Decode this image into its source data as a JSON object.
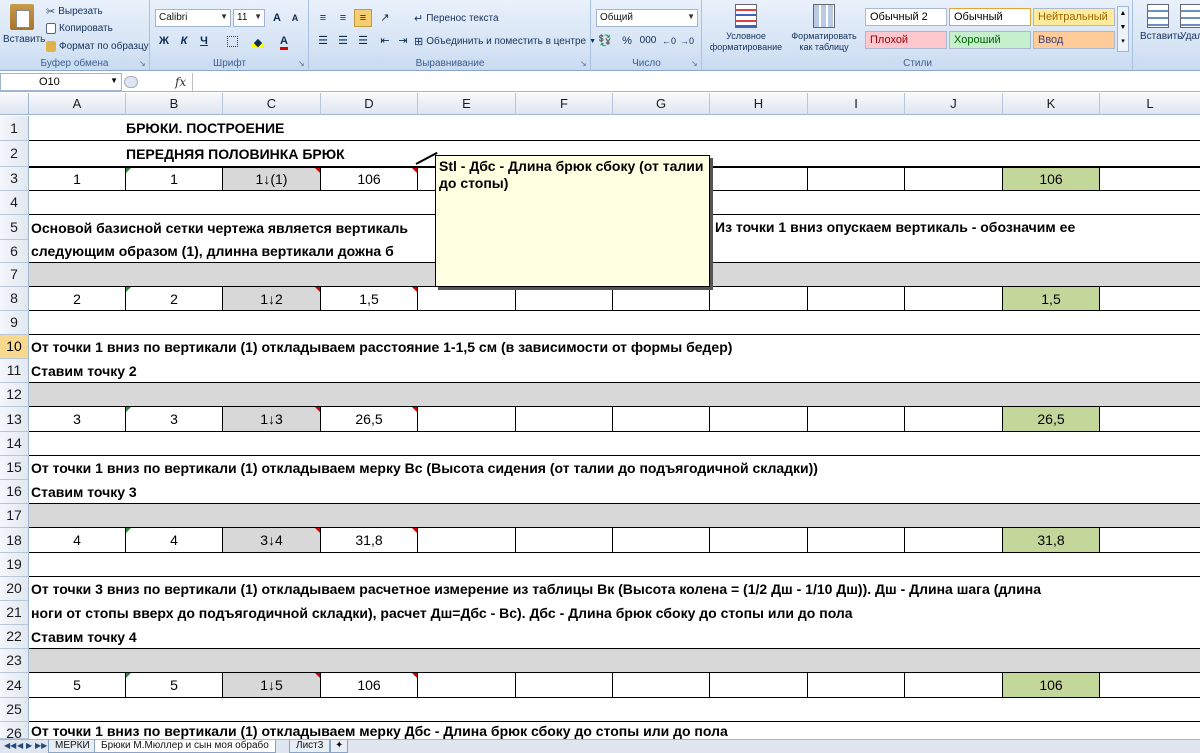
{
  "ribbon": {
    "clipboard": {
      "paste": "Вставить",
      "cut": "Вырезать",
      "copy": "Копировать",
      "format_painter": "Формат по образцу",
      "label": "Буфер обмена"
    },
    "font": {
      "name": "Calibri",
      "size": "11",
      "bold": "Ж",
      "italic": "К",
      "underline": "Ч",
      "grow": "A",
      "shrink": "A",
      "label": "Шрифт"
    },
    "alignment": {
      "wrap": "Перенос текста",
      "merge": "Объединить и поместить в центре",
      "label": "Выравнивание"
    },
    "number": {
      "format": "Общий",
      "percent": "%",
      "thousands": "000",
      "label": "Число"
    },
    "styles": {
      "cond_format": "Условное форматирование",
      "format_table": "Форматировать как таблицу",
      "cells": [
        "Обычный 2",
        "Обычный",
        "Нейтральный",
        "Плохой",
        "Хороший",
        "Ввод"
      ],
      "colors": {
        "neutral": "#ffeb9c",
        "bad": "#ffc7ce",
        "good": "#c6efce",
        "input": "#ffcc99"
      },
      "label": "Стили"
    },
    "cells_group": {
      "insert": "Вставить",
      "delete": "Удал"
    }
  },
  "formula_bar": {
    "name_box": "O10",
    "fx": "fx",
    "content": ""
  },
  "columns": [
    "A",
    "B",
    "C",
    "D",
    "E",
    "F",
    "G",
    "H",
    "I",
    "J",
    "K",
    "L"
  ],
  "rows": [
    "1",
    "2",
    "3",
    "4",
    "5",
    "6",
    "7",
    "8",
    "9",
    "10",
    "11",
    "12",
    "13",
    "14",
    "15",
    "16",
    "17",
    "18",
    "19",
    "20",
    "21",
    "22",
    "23",
    "24",
    "25",
    "26"
  ],
  "sheet": {
    "r1": "БРЮКИ. ПОСТРОЕНИЕ",
    "r2": "ПЕРЕДНЯЯ ПОЛОВИНКА БРЮК",
    "r3": {
      "a": "1",
      "b": "1",
      "c": "1↓(1)",
      "d": "106",
      "k": "106"
    },
    "r5": "Основой базисной сетки чертежа является вертикаль",
    "r5_right": "Из точки 1 вниз опускаем вертикаль - обозначим ее",
    "r6": "следующим образом (1), длинна вертикали дожна б",
    "r8": {
      "a": "2",
      "b": "2",
      "c": "1↓2",
      "d": "1,5",
      "k": "1,5"
    },
    "r10": "От  точки 1 вниз по вертикали (1) откладываем расстояние 1-1,5 см (в зависимости от формы бедер)",
    "r11": "Ставим точку 2",
    "r13": {
      "a": "3",
      "b": "3",
      "c": "1↓3",
      "d": "26,5",
      "k": "26,5"
    },
    "r15": "От  точки 1 вниз по вертикали (1) откладываем мерку Вс (Высота сидения (от талии до подъягодичной складки))",
    "r16": "Ставим точку 3",
    "r18": {
      "a": "4",
      "b": "4",
      "c": "3↓4",
      "d": "31,8",
      "k": "31,8"
    },
    "r20": "От  точки 3 вниз по вертикали (1) откладываем расчетное измерение из таблицы Вк (Высота колена = (1/2 Дш - 1/10 Дш)).  Дш - Длина шага (длина",
    "r21": "ноги от стопы вверх до подъягодичной складки), расчет Дш=Дбс - Вс). Дбс - Длина брюк сбоку до стопы или до пола",
    "r22": "Ставим точку 4",
    "r24": {
      "a": "5",
      "b": "5",
      "c": "1↓5",
      "d": "106",
      "k": "106"
    },
    "r26": "От  точки 1 вниз по вертикали (1) откладываем мерку Дбс - Длина брюк сбоку до стопы или до пола"
  },
  "comment": "Stl - Дбс - Длина брюк сбоку (от талии до стопы)",
  "tabs": [
    "МЕРКИ",
    "Брюки М.Мюллер и сын моя обрабо",
    "Лист3"
  ]
}
